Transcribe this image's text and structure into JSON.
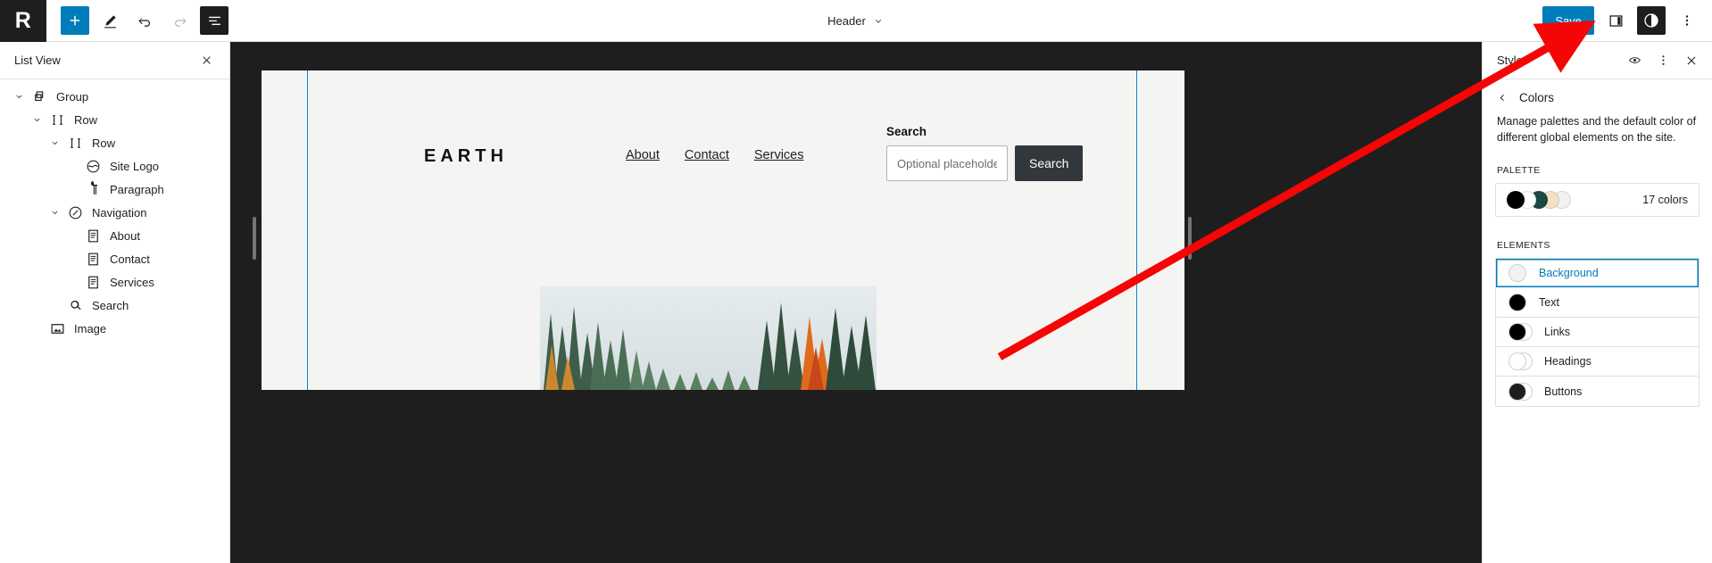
{
  "toolbar": {
    "site_icon_letter": "R",
    "add_block_label": "add-block",
    "tools": [
      {
        "name": "add-block-button",
        "icon": "plus-icon"
      },
      {
        "name": "edit-tool-button",
        "icon": "pencil-icon"
      },
      {
        "name": "undo-button",
        "icon": "undo-icon"
      },
      {
        "name": "redo-button",
        "icon": "redo-icon"
      },
      {
        "name": "list-view-button",
        "icon": "list-view-icon"
      }
    ],
    "document_title": "Header",
    "save_label": "Save",
    "settings_icon": "sidebar-toggle-icon",
    "styles_icon": "contrast-circle-icon",
    "options_icon": "three-dots-vertical-icon"
  },
  "list_view": {
    "title": "List View",
    "close_icon": "close-icon",
    "items": [
      {
        "label": "Group",
        "icon": "group-icon",
        "depth": 0,
        "expanded": true,
        "has_caret": true
      },
      {
        "label": "Row",
        "icon": "row-icon",
        "depth": 1,
        "expanded": true,
        "has_caret": true
      },
      {
        "label": "Row",
        "icon": "row-icon",
        "depth": 2,
        "expanded": true,
        "has_caret": true
      },
      {
        "label": "Site Logo",
        "icon": "site-logo-icon",
        "depth": 3,
        "expanded": false,
        "has_caret": false
      },
      {
        "label": "Paragraph",
        "icon": "paragraph-icon",
        "depth": 3,
        "expanded": false,
        "has_caret": false
      },
      {
        "label": "Navigation",
        "icon": "navigation-icon",
        "depth": 2,
        "expanded": true,
        "has_caret": true
      },
      {
        "label": "About",
        "icon": "page-icon",
        "depth": 3,
        "expanded": false,
        "has_caret": false
      },
      {
        "label": "Contact",
        "icon": "page-icon",
        "depth": 3,
        "expanded": false,
        "has_caret": false
      },
      {
        "label": "Services",
        "icon": "page-icon",
        "depth": 3,
        "expanded": false,
        "has_caret": false
      },
      {
        "label": "Search",
        "icon": "search-icon",
        "depth": 2,
        "expanded": false,
        "has_caret": false
      },
      {
        "label": "Image",
        "icon": "image-icon",
        "depth": 1,
        "expanded": false,
        "has_caret": false
      }
    ]
  },
  "canvas": {
    "brand": "EARTH",
    "nav_links": [
      "About",
      "Contact",
      "Services"
    ],
    "search": {
      "label": "Search",
      "placeholder": "Optional placeholder...",
      "button_label": "Search"
    },
    "image_alt": "forest-image-block"
  },
  "inspector": {
    "panel_title": "Styles",
    "preview_icon": "eye-icon",
    "more_icon": "three-dots-vertical-icon",
    "close_icon": "close-icon",
    "back_icon": "chevron-left-icon",
    "screen_title": "Colors",
    "description": "Manage palettes and the default color of different global elements on the site.",
    "palette_section_label": "PALETTE",
    "palette_count": "17 colors",
    "palette_swatches": [
      "#000000",
      "#ffffff",
      "#1b4a45",
      "#f7dfc4",
      "#f2f2f2"
    ],
    "elements_section_label": "ELEMENTS",
    "elements": [
      {
        "label": "Background",
        "selected": true,
        "dots": [
          "#f2f2f2"
        ]
      },
      {
        "label": "Text",
        "selected": false,
        "dots": [
          "#000000"
        ]
      },
      {
        "label": "Links",
        "selected": false,
        "dots": [
          "#000000",
          "#ffffff"
        ]
      },
      {
        "label": "Headings",
        "selected": false,
        "dots": [
          "#ffffff",
          "#ffffff"
        ]
      },
      {
        "label": "Buttons",
        "selected": false,
        "dots": [
          "#1e1e1e",
          "#ffffff"
        ]
      }
    ]
  },
  "annotation": {
    "arrow_color": "#f50505",
    "arrow_name": "red-pointer-arrow"
  },
  "colors": {
    "accent": "#007cba",
    "chrome_dark": "#1e1e1e",
    "canvas_bg": "#f4f4f3"
  }
}
